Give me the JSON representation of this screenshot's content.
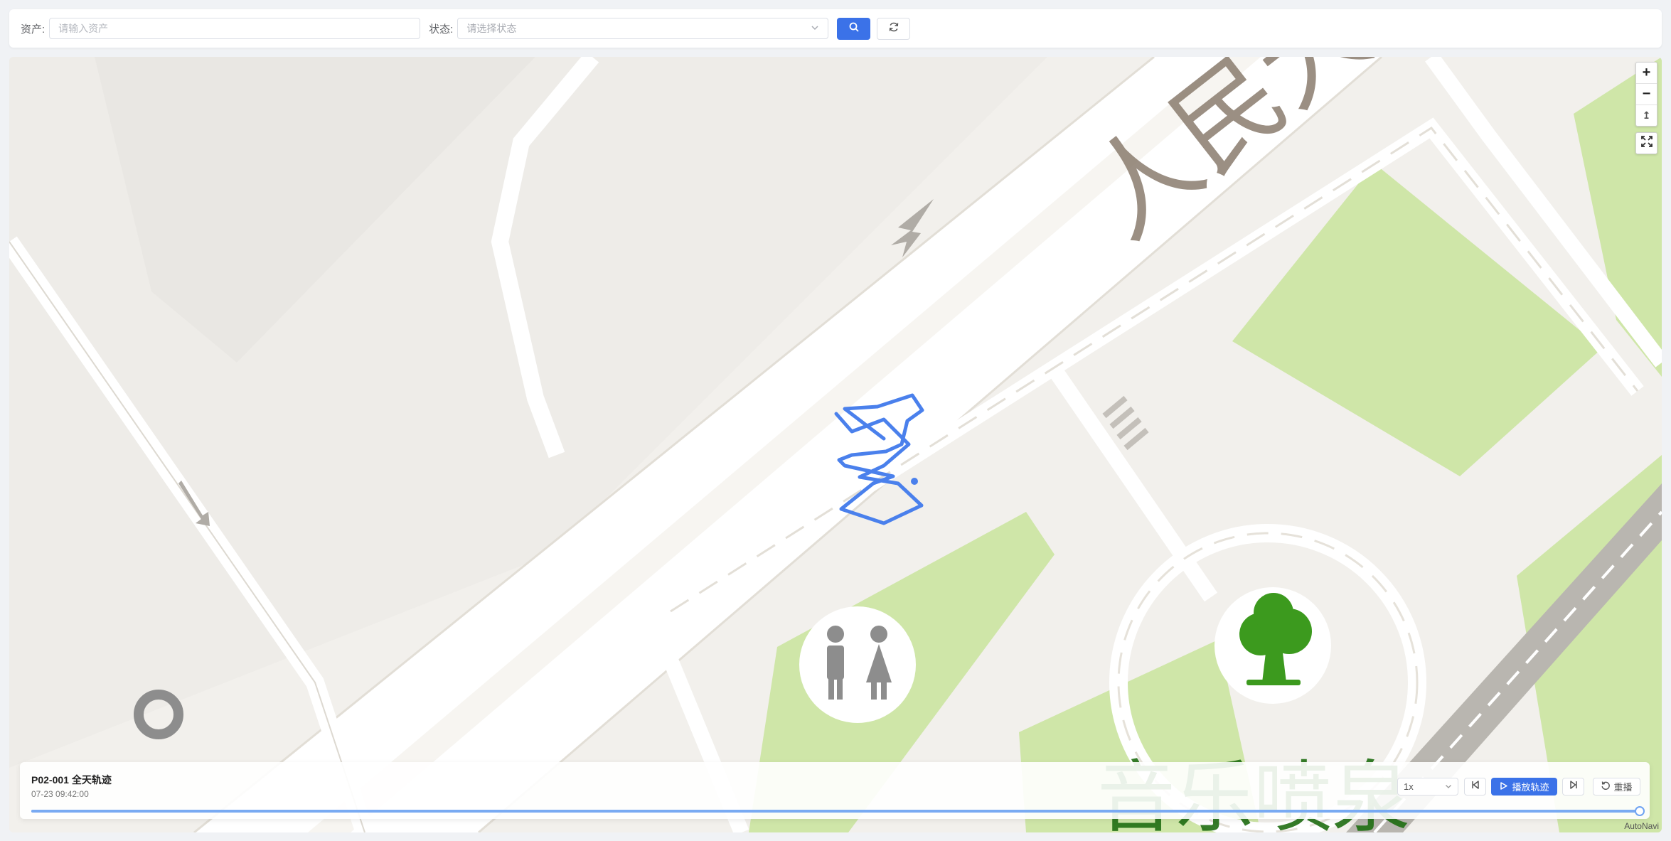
{
  "filter": {
    "asset_label": "资产:",
    "asset_placeholder": "请输入资产",
    "status_label": "状态:",
    "status_placeholder": "请选择状态"
  },
  "icons": {
    "search": "search-icon",
    "refresh": "refresh-icon",
    "zoom_in": "plus-icon",
    "zoom_out": "minus-icon",
    "compass": "compass-icon",
    "fullscreen": "fullscreen-icon",
    "play": "play-icon",
    "prev": "skip-back-icon",
    "next": "skip-forward-icon",
    "replay": "replay-icon"
  },
  "map": {
    "zoom_in_label": "+",
    "zoom_out_label": "−",
    "compass_label": "↥",
    "attribution": "AutoNavi",
    "road_label": "人民大",
    "park_label": "音乐喷泉"
  },
  "playback": {
    "title": "P02-001 全天轨迹",
    "time": "07-23 09:42:00",
    "speed": "1x",
    "play_label": "播放轨迹",
    "replay_label": "重播",
    "progress": 1.0
  },
  "colors": {
    "accent": "#3b72e8",
    "track": "#4a80ec",
    "park": "#cfe6a8",
    "road": "#ffffff"
  }
}
